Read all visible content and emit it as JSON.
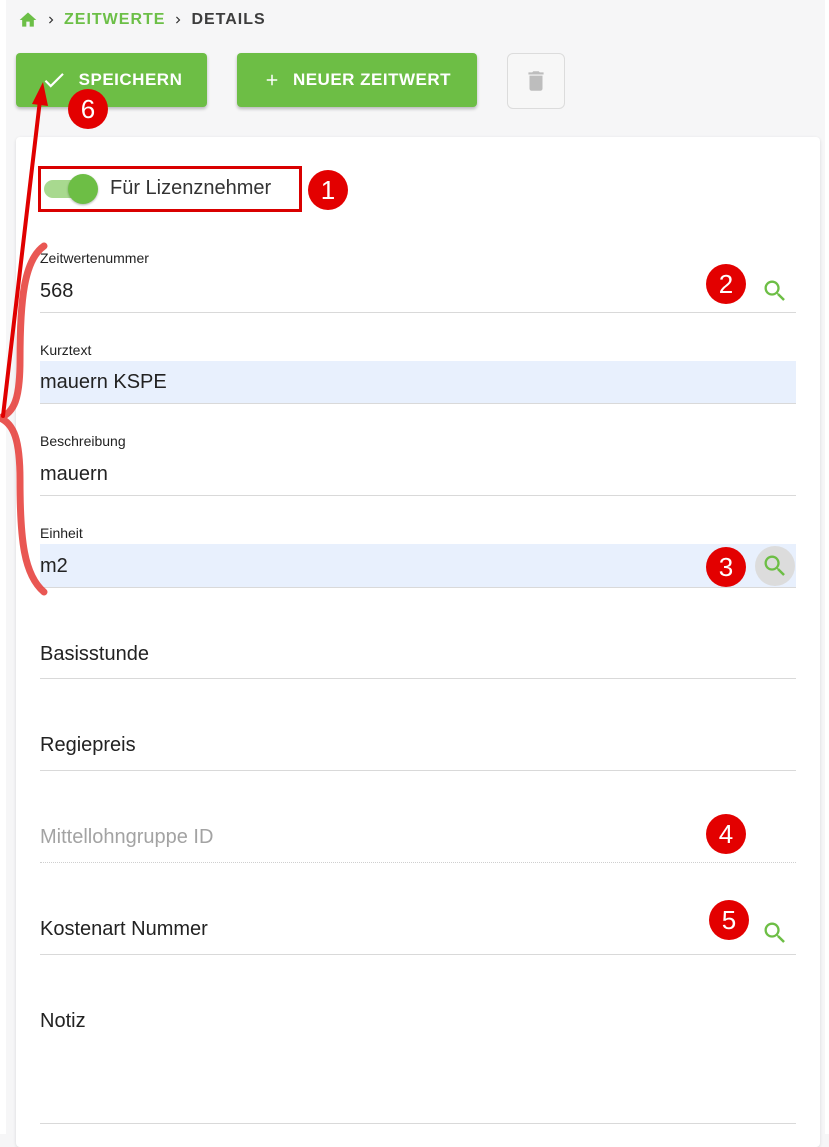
{
  "breadcrumb": {
    "items": [
      "ZEITWERTE",
      "DETAILS"
    ]
  },
  "toolbar": {
    "save_label": "SPEICHERN",
    "new_label": "NEUER ZEITWERT"
  },
  "toggle": {
    "label": "Für Lizenznehmer",
    "checked": true
  },
  "fields": {
    "zeitwertenummer": {
      "label": "Zeitwertenummer",
      "value": "568"
    },
    "kurztext": {
      "label": "Kurztext",
      "value": "mauern KSPE"
    },
    "beschreibung": {
      "label": "Beschreibung",
      "value": "mauern"
    },
    "einheit": {
      "label": "Einheit",
      "value": "m2"
    },
    "basisstunde": {
      "placeholder": "Basisstunde"
    },
    "regiepreis": {
      "placeholder": "Regiepreis"
    },
    "mittellohngruppe": {
      "placeholder": "Mittellohngruppe ID"
    },
    "kostenart": {
      "placeholder": "Kostenart Nummer"
    },
    "notiz": {
      "placeholder": "Notiz"
    }
  },
  "annotations": [
    "1",
    "2",
    "3",
    "4",
    "5",
    "6"
  ],
  "colors": {
    "accent": "#6dbe45",
    "annotation": "#e30000",
    "autofill": "#e8f0fd"
  }
}
